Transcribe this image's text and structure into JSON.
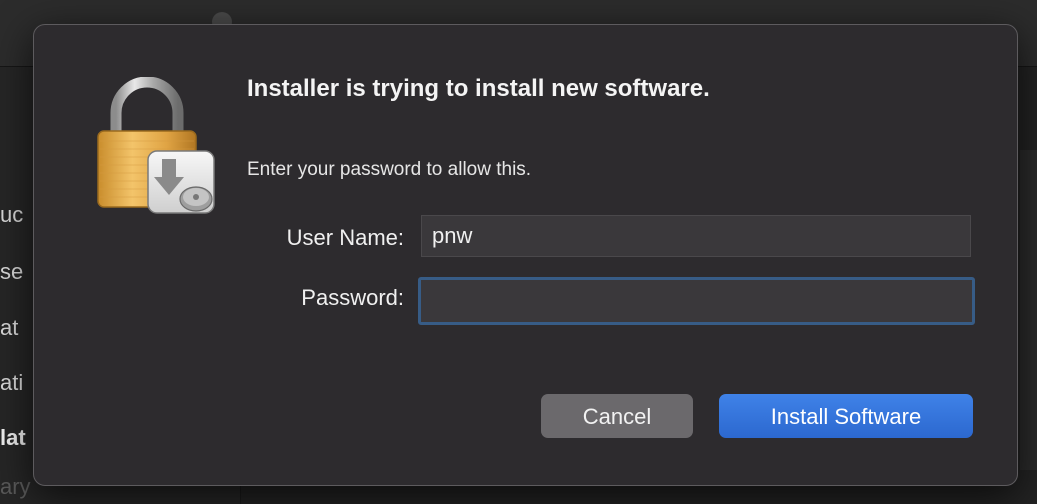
{
  "background": {
    "sidebar_items": [
      {
        "label": "uc"
      },
      {
        "label": "se"
      },
      {
        "label": "at"
      },
      {
        "label": "ati"
      },
      {
        "label": "lat"
      },
      {
        "label": "ary"
      }
    ]
  },
  "dialog": {
    "icon": "lock-with-installer-disk-icon",
    "title": "Installer is trying to install new software.",
    "subtitle": "Enter your password to allow this.",
    "username_label": "User Name:",
    "username_value": "pnw",
    "password_label": "Password:",
    "password_value": "",
    "cancel_label": "Cancel",
    "install_label": "Install Software"
  },
  "colors": {
    "accent": "#2f6fd6",
    "focus_ring": "#375c86",
    "dialog_bg": "#2d2b2e"
  }
}
